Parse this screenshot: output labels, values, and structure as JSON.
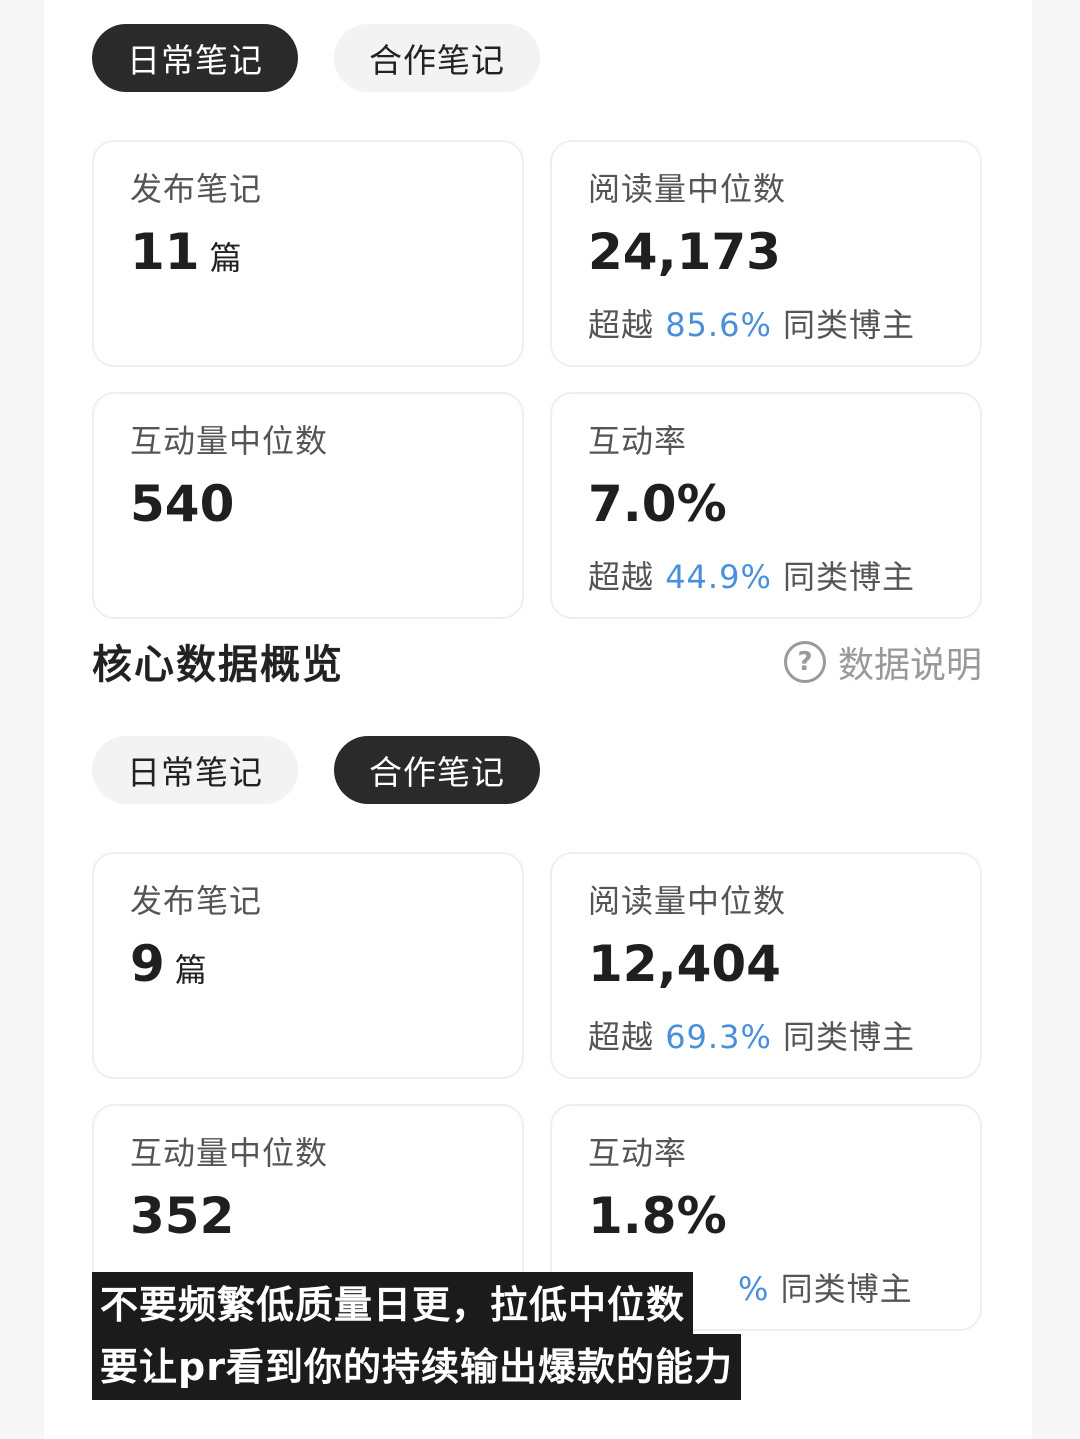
{
  "tabs": {
    "daily": "日常笔记",
    "collab": "合作笔记"
  },
  "block1": {
    "published": {
      "label": "发布笔记",
      "value": "11",
      "unit": "篇"
    },
    "reads": {
      "label": "阅读量中位数",
      "value": "24,173",
      "prefix": "超越",
      "pct": "85.6%",
      "suffix": "同类博主"
    },
    "interactions": {
      "label": "互动量中位数",
      "value": "540"
    },
    "rate": {
      "label": "互动率",
      "value": "7.0%",
      "prefix": "超越",
      "pct": "44.9%",
      "suffix": "同类博主"
    }
  },
  "overview": {
    "title": "核心数据概览",
    "help_icon": "question-circle-icon",
    "help_label": "数据说明"
  },
  "block2": {
    "published": {
      "label": "发布笔记",
      "value": "9",
      "unit": "篇"
    },
    "reads": {
      "label": "阅读量中位数",
      "value": "12,404",
      "prefix": "超越",
      "pct": "69.3%",
      "suffix": "同类博主"
    },
    "interactions": {
      "label": "互动量中位数",
      "value": "352"
    },
    "rate": {
      "label": "互动率",
      "value": "1.8%",
      "pct_partial": "%",
      "suffix": "同类博主"
    }
  },
  "caption": {
    "line1": "不要频繁低质量日更，拉低中位数",
    "line2": "要让pr看到你的持续输出爆款的能力"
  },
  "colors": {
    "accent": "#4a90d9",
    "active_tab": "#2a2a2a",
    "inactive_tab": "#f3f3f3"
  }
}
